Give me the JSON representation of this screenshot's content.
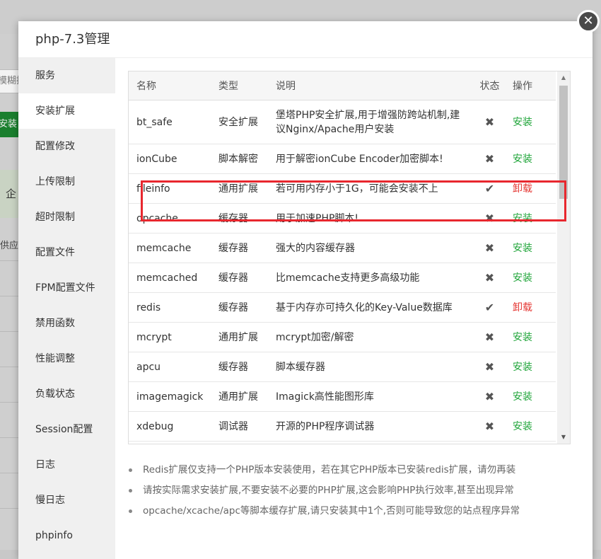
{
  "background": {
    "input_text": "模糊搜",
    "green_button": "安装",
    "band_text": "企",
    "header_text": "供应商"
  },
  "modal": {
    "title": "php-7.3管理",
    "close_icon": "close-icon"
  },
  "sidebar": {
    "items": [
      {
        "label": "服务"
      },
      {
        "label": "安装扩展"
      },
      {
        "label": "配置修改"
      },
      {
        "label": "上传限制"
      },
      {
        "label": "超时限制"
      },
      {
        "label": "配置文件"
      },
      {
        "label": "FPM配置文件"
      },
      {
        "label": "禁用函数"
      },
      {
        "label": "性能调整"
      },
      {
        "label": "负载状态"
      },
      {
        "label": "Session配置"
      },
      {
        "label": "日志"
      },
      {
        "label": "慢日志"
      },
      {
        "label": "phpinfo"
      }
    ]
  },
  "table": {
    "headers": {
      "name": "名称",
      "type": "类型",
      "desc": "说明",
      "status": "状态",
      "op": "操作"
    },
    "rows": [
      {
        "name": "bt_safe",
        "type": "安全扩展",
        "desc": "堡塔PHP安全扩展,用于增强防跨站机制,建议Nginx/Apache用户安装",
        "status": "✖",
        "op": "安装"
      },
      {
        "name": "ionCube",
        "type": "脚本解密",
        "desc": "用于解密ionCube Encoder加密脚本!",
        "status": "✖",
        "op": "安装"
      },
      {
        "name": "fileinfo",
        "type": "通用扩展",
        "desc": "若可用内存小于1G，可能会安装不上",
        "status": "✔",
        "op": "卸载"
      },
      {
        "name": "opcache",
        "type": "缓存器",
        "desc": "用于加速PHP脚本!",
        "status": "✖",
        "op": "安装"
      },
      {
        "name": "memcache",
        "type": "缓存器",
        "desc": "强大的内容缓存器",
        "status": "✖",
        "op": "安装"
      },
      {
        "name": "memcached",
        "type": "缓存器",
        "desc": "比memcache支持更多高级功能",
        "status": "✖",
        "op": "安装"
      },
      {
        "name": "redis",
        "type": "缓存器",
        "desc": "基于内存亦可持久化的Key-Value数据库",
        "status": "✔",
        "op": "卸载"
      },
      {
        "name": "mcrypt",
        "type": "通用扩展",
        "desc": "mcrypt加密/解密",
        "status": "✖",
        "op": "安装"
      },
      {
        "name": "apcu",
        "type": "缓存器",
        "desc": "脚本缓存器",
        "status": "✖",
        "op": "安装"
      },
      {
        "name": "imagemagick",
        "type": "通用扩展",
        "desc": "Imagick高性能图形库",
        "status": "✖",
        "op": "安装"
      },
      {
        "name": "xdebug",
        "type": "调试器",
        "desc": "开源的PHP程序调试器",
        "status": "✖",
        "op": "安装"
      }
    ],
    "op_colors": {
      "install": "#20a53a",
      "uninstall": "#e53935"
    }
  },
  "notes": [
    "Redis扩展仅支持一个PHP版本安装使用，若在其它PHP版本已安装redis扩展，请勿再装",
    "请按实际需求安装扩展,不要安装不必要的PHP扩展,这会影响PHP执行效率,甚至出现异常",
    "opcache/xcache/apc等脚本缓存扩展,请只安装其中1个,否则可能导致您的站点程序异常"
  ]
}
